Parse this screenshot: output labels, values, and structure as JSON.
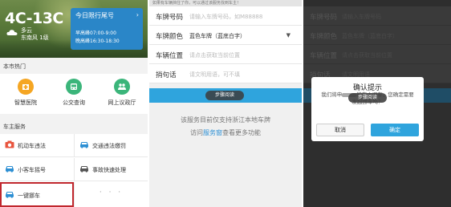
{
  "screen1": {
    "weather": {
      "temperature": "4C-13C",
      "condition": "多云",
      "detail": "东南风 1级"
    },
    "plate_limit": {
      "title": "今日限行尾号",
      "line1": "早高峰07:00-9:00",
      "line2": "晚高峰16:30-18:30"
    },
    "hot_section_title": "本市热门",
    "hot_items": [
      {
        "label": "智慧医院",
        "color": "#f5a623"
      },
      {
        "label": "公交查询",
        "color": "#3bb57a"
      },
      {
        "label": "网上议政厅",
        "color": "#3bb57a"
      }
    ],
    "service_section_title": "车主服务",
    "services": [
      {
        "label": "机动车违法",
        "icon": "camera-icon",
        "color": "#e8553e"
      },
      {
        "label": "交通违法缴罚",
        "icon": "car-icon",
        "color": "#2d8fd3"
      },
      {
        "label": "小客车摇号",
        "icon": "car-icon",
        "color": "#2d8fd3"
      },
      {
        "label": "事故快速处理",
        "icon": "car-crash-icon",
        "color": "#555555"
      },
      {
        "label": "一键挪车",
        "icon": "car-icon",
        "color": "#2d8fd3"
      },
      {
        "label": "· · ·",
        "icon": "more-icon",
        "color": "#999999"
      }
    ]
  },
  "screen2": {
    "banner": "如果有车辆挡住了你，可以通过该服务找到车主！",
    "fields": [
      {
        "label": "车牌号码",
        "value": "请输入车牌号码，如M88888",
        "placeholder": true
      },
      {
        "label": "车牌颜色",
        "value": "蓝色车牌（蓝底白字）",
        "placeholder": false,
        "dropdown": true
      },
      {
        "label": "车辆位置",
        "value": "请点击获取当前位置",
        "placeholder": true
      },
      {
        "label": "捎句话",
        "value": "请文明用语，可不填",
        "placeholder": true
      }
    ],
    "submit_toast": "步骤阅读",
    "note1": "该服务目前仅支持浙江本地车牌",
    "note2_prefix": "访问",
    "note2_link": "服务窗",
    "note2_suffix": "查看更多功能"
  },
  "screen3": {
    "fields": [
      {
        "label": "车牌号码",
        "value": "请输入车牌号码"
      },
      {
        "label": "车牌颜色",
        "value": "蓝色车牌（蓝底白字）"
      },
      {
        "label": "车辆位置",
        "value": "请点击获取当前位置"
      },
      {
        "label": "捎句话",
        "value": "请文明用语"
      }
    ],
    "dialog": {
      "title": "确认提示",
      "message_prefix": "我们将申",
      "message_suffix": "的车主挪车，您确定需要发起挪车吗？",
      "toast": "步骤阅读",
      "cancel": "取消",
      "confirm": "确定"
    }
  }
}
